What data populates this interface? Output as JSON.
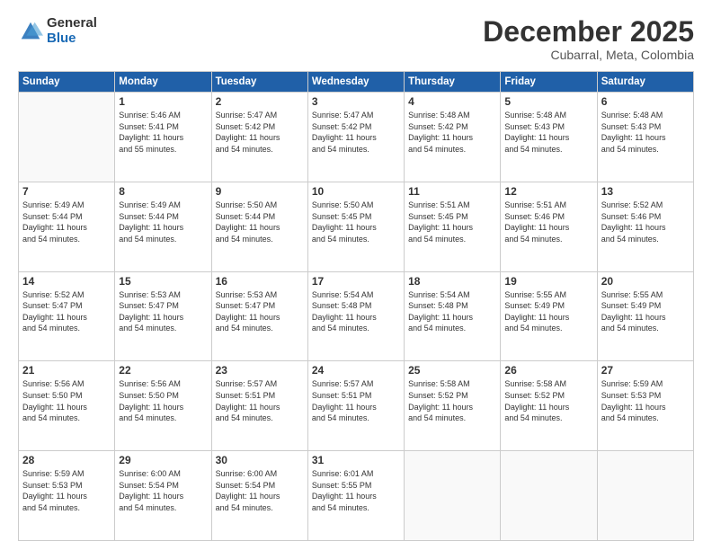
{
  "logo": {
    "general": "General",
    "blue": "Blue"
  },
  "title": "December 2025",
  "subtitle": "Cubarral, Meta, Colombia",
  "days_of_week": [
    "Sunday",
    "Monday",
    "Tuesday",
    "Wednesday",
    "Thursday",
    "Friday",
    "Saturday"
  ],
  "weeks": [
    [
      {
        "day": "",
        "info": ""
      },
      {
        "day": "1",
        "info": "Sunrise: 5:46 AM\nSunset: 5:41 PM\nDaylight: 11 hours\nand 55 minutes."
      },
      {
        "day": "2",
        "info": "Sunrise: 5:47 AM\nSunset: 5:42 PM\nDaylight: 11 hours\nand 54 minutes."
      },
      {
        "day": "3",
        "info": "Sunrise: 5:47 AM\nSunset: 5:42 PM\nDaylight: 11 hours\nand 54 minutes."
      },
      {
        "day": "4",
        "info": "Sunrise: 5:48 AM\nSunset: 5:42 PM\nDaylight: 11 hours\nand 54 minutes."
      },
      {
        "day": "5",
        "info": "Sunrise: 5:48 AM\nSunset: 5:43 PM\nDaylight: 11 hours\nand 54 minutes."
      },
      {
        "day": "6",
        "info": "Sunrise: 5:48 AM\nSunset: 5:43 PM\nDaylight: 11 hours\nand 54 minutes."
      }
    ],
    [
      {
        "day": "7",
        "info": "Sunrise: 5:49 AM\nSunset: 5:44 PM\nDaylight: 11 hours\nand 54 minutes."
      },
      {
        "day": "8",
        "info": "Sunrise: 5:49 AM\nSunset: 5:44 PM\nDaylight: 11 hours\nand 54 minutes."
      },
      {
        "day": "9",
        "info": "Sunrise: 5:50 AM\nSunset: 5:44 PM\nDaylight: 11 hours\nand 54 minutes."
      },
      {
        "day": "10",
        "info": "Sunrise: 5:50 AM\nSunset: 5:45 PM\nDaylight: 11 hours\nand 54 minutes."
      },
      {
        "day": "11",
        "info": "Sunrise: 5:51 AM\nSunset: 5:45 PM\nDaylight: 11 hours\nand 54 minutes."
      },
      {
        "day": "12",
        "info": "Sunrise: 5:51 AM\nSunset: 5:46 PM\nDaylight: 11 hours\nand 54 minutes."
      },
      {
        "day": "13",
        "info": "Sunrise: 5:52 AM\nSunset: 5:46 PM\nDaylight: 11 hours\nand 54 minutes."
      }
    ],
    [
      {
        "day": "14",
        "info": "Sunrise: 5:52 AM\nSunset: 5:47 PM\nDaylight: 11 hours\nand 54 minutes."
      },
      {
        "day": "15",
        "info": "Sunrise: 5:53 AM\nSunset: 5:47 PM\nDaylight: 11 hours\nand 54 minutes."
      },
      {
        "day": "16",
        "info": "Sunrise: 5:53 AM\nSunset: 5:47 PM\nDaylight: 11 hours\nand 54 minutes."
      },
      {
        "day": "17",
        "info": "Sunrise: 5:54 AM\nSunset: 5:48 PM\nDaylight: 11 hours\nand 54 minutes."
      },
      {
        "day": "18",
        "info": "Sunrise: 5:54 AM\nSunset: 5:48 PM\nDaylight: 11 hours\nand 54 minutes."
      },
      {
        "day": "19",
        "info": "Sunrise: 5:55 AM\nSunset: 5:49 PM\nDaylight: 11 hours\nand 54 minutes."
      },
      {
        "day": "20",
        "info": "Sunrise: 5:55 AM\nSunset: 5:49 PM\nDaylight: 11 hours\nand 54 minutes."
      }
    ],
    [
      {
        "day": "21",
        "info": "Sunrise: 5:56 AM\nSunset: 5:50 PM\nDaylight: 11 hours\nand 54 minutes."
      },
      {
        "day": "22",
        "info": "Sunrise: 5:56 AM\nSunset: 5:50 PM\nDaylight: 11 hours\nand 54 minutes."
      },
      {
        "day": "23",
        "info": "Sunrise: 5:57 AM\nSunset: 5:51 PM\nDaylight: 11 hours\nand 54 minutes."
      },
      {
        "day": "24",
        "info": "Sunrise: 5:57 AM\nSunset: 5:51 PM\nDaylight: 11 hours\nand 54 minutes."
      },
      {
        "day": "25",
        "info": "Sunrise: 5:58 AM\nSunset: 5:52 PM\nDaylight: 11 hours\nand 54 minutes."
      },
      {
        "day": "26",
        "info": "Sunrise: 5:58 AM\nSunset: 5:52 PM\nDaylight: 11 hours\nand 54 minutes."
      },
      {
        "day": "27",
        "info": "Sunrise: 5:59 AM\nSunset: 5:53 PM\nDaylight: 11 hours\nand 54 minutes."
      }
    ],
    [
      {
        "day": "28",
        "info": "Sunrise: 5:59 AM\nSunset: 5:53 PM\nDaylight: 11 hours\nand 54 minutes."
      },
      {
        "day": "29",
        "info": "Sunrise: 6:00 AM\nSunset: 5:54 PM\nDaylight: 11 hours\nand 54 minutes."
      },
      {
        "day": "30",
        "info": "Sunrise: 6:00 AM\nSunset: 5:54 PM\nDaylight: 11 hours\nand 54 minutes."
      },
      {
        "day": "31",
        "info": "Sunrise: 6:01 AM\nSunset: 5:55 PM\nDaylight: 11 hours\nand 54 minutes."
      },
      {
        "day": "",
        "info": ""
      },
      {
        "day": "",
        "info": ""
      },
      {
        "day": "",
        "info": ""
      }
    ]
  ]
}
